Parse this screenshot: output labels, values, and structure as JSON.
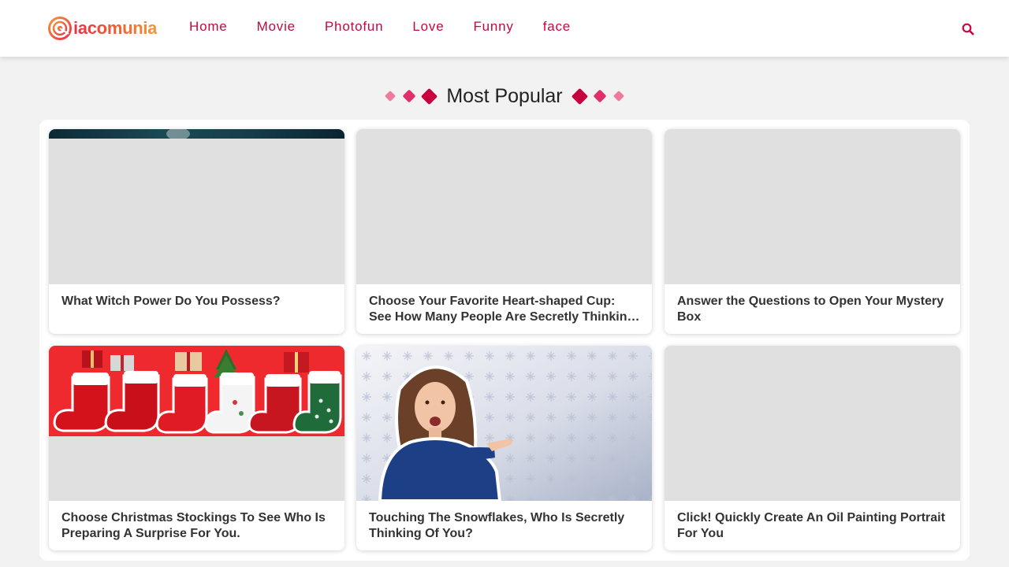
{
  "brand": {
    "name": "iacomunia",
    "logo_color_start": "#e8324a",
    "logo_color_end": "#f5963a"
  },
  "nav": {
    "items": [
      "Home",
      "Movie",
      "Photofun",
      "Love",
      "Funny",
      "face"
    ],
    "link_color": "#c3093f"
  },
  "search": {
    "icon": "search-icon"
  },
  "section": {
    "title": "Most Popular"
  },
  "cards": [
    {
      "title": "What Witch Power Do You Possess?"
    },
    {
      "title": "Choose Your Favorite Heart-shaped Cup: See How Many People Are Secretly Thinking of You"
    },
    {
      "title": "Answer the Questions to Open Your Mystery Box"
    },
    {
      "title": "Choose Christmas Stockings To See Who Is Preparing A Surprise For You."
    },
    {
      "title": "Touching The Snowflakes, Who Is Secretly Thinking Of You?"
    },
    {
      "title": "Click! Quickly Create An Oil Painting Portrait For You"
    }
  ],
  "colors": {
    "accent": "#c8003e",
    "accent_mid": "#e0306a",
    "accent_light": "#ef7b9c",
    "placeholder": "#e0e0e0",
    "background": "#f2f2f2"
  }
}
